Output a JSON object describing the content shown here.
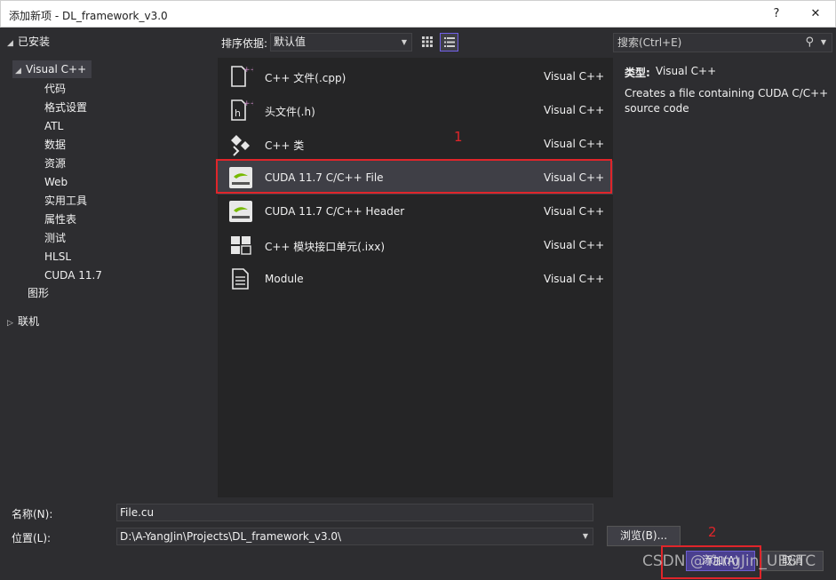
{
  "window": {
    "title": "添加新项 - DL_framework_v3.0",
    "help": "?",
    "close": "✕"
  },
  "tree": {
    "installed": "已安装",
    "visual_cpp": "Visual C++",
    "children": [
      "代码",
      "格式设置",
      "ATL",
      "数据",
      "资源",
      "Web",
      "实用工具",
      "属性表",
      "测试",
      "HLSL",
      "CUDA 11.7"
    ],
    "graphics": "图形",
    "online": "联机"
  },
  "toolbar": {
    "sort_label": "排序依据:",
    "sort_value": "默认值",
    "search_placeholder": "搜索(Ctrl+E)"
  },
  "templates": [
    {
      "name": "C++ 文件(.cpp)",
      "lang": "Visual C++",
      "icon": "cpp-file-icon"
    },
    {
      "name": "头文件(.h)",
      "lang": "Visual C++",
      "icon": "header-file-icon"
    },
    {
      "name": "C++ 类",
      "lang": "Visual C++",
      "icon": "class-icon"
    },
    {
      "name": "CUDA 11.7 C/C++ File",
      "lang": "Visual C++",
      "icon": "nvidia-icon"
    },
    {
      "name": "CUDA 11.7 C/C++ Header",
      "lang": "Visual C++",
      "icon": "nvidia-icon"
    },
    {
      "name": "C++ 模块接口单元(.ixx)",
      "lang": "Visual C++",
      "icon": "module-interface-icon"
    },
    {
      "name": "Module",
      "lang": "Visual C++",
      "icon": "module-file-icon"
    }
  ],
  "selected_template": "CUDA 11.7 C/C++ File",
  "info": {
    "type_label": "类型:",
    "type_value": "Visual C++",
    "description": "Creates a file containing CUDA C/C++ source code"
  },
  "form": {
    "name_label": "名称(N):",
    "name_value": "File.cu",
    "location_label": "位置(L):",
    "location_value": "D:\\A-YangJin\\Projects\\DL_framework_v3.0\\",
    "browse": "浏览(B)...",
    "add": "添加(A)",
    "cancel": "取消"
  },
  "annotations": {
    "one": "1",
    "two": "2"
  },
  "watermark": "CSDN @YangJin_UESTC",
  "colors": {
    "highlight": "#e0252a",
    "accent": "#7160e8"
  }
}
